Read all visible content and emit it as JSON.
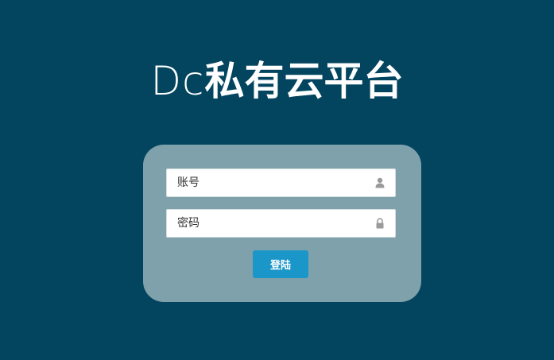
{
  "title": {
    "brand": "Dc",
    "name": "私有云平台"
  },
  "form": {
    "username_placeholder": "账号",
    "username_value": "",
    "password_placeholder": "密码",
    "password_value": "",
    "username_icon": "user-icon",
    "password_icon": "lock-icon",
    "login_label": "登陆"
  },
  "colors": {
    "background": "#03455f",
    "panel": "#7fa1ab",
    "button": "#1b96c9",
    "icon": "#9a9a9a"
  }
}
